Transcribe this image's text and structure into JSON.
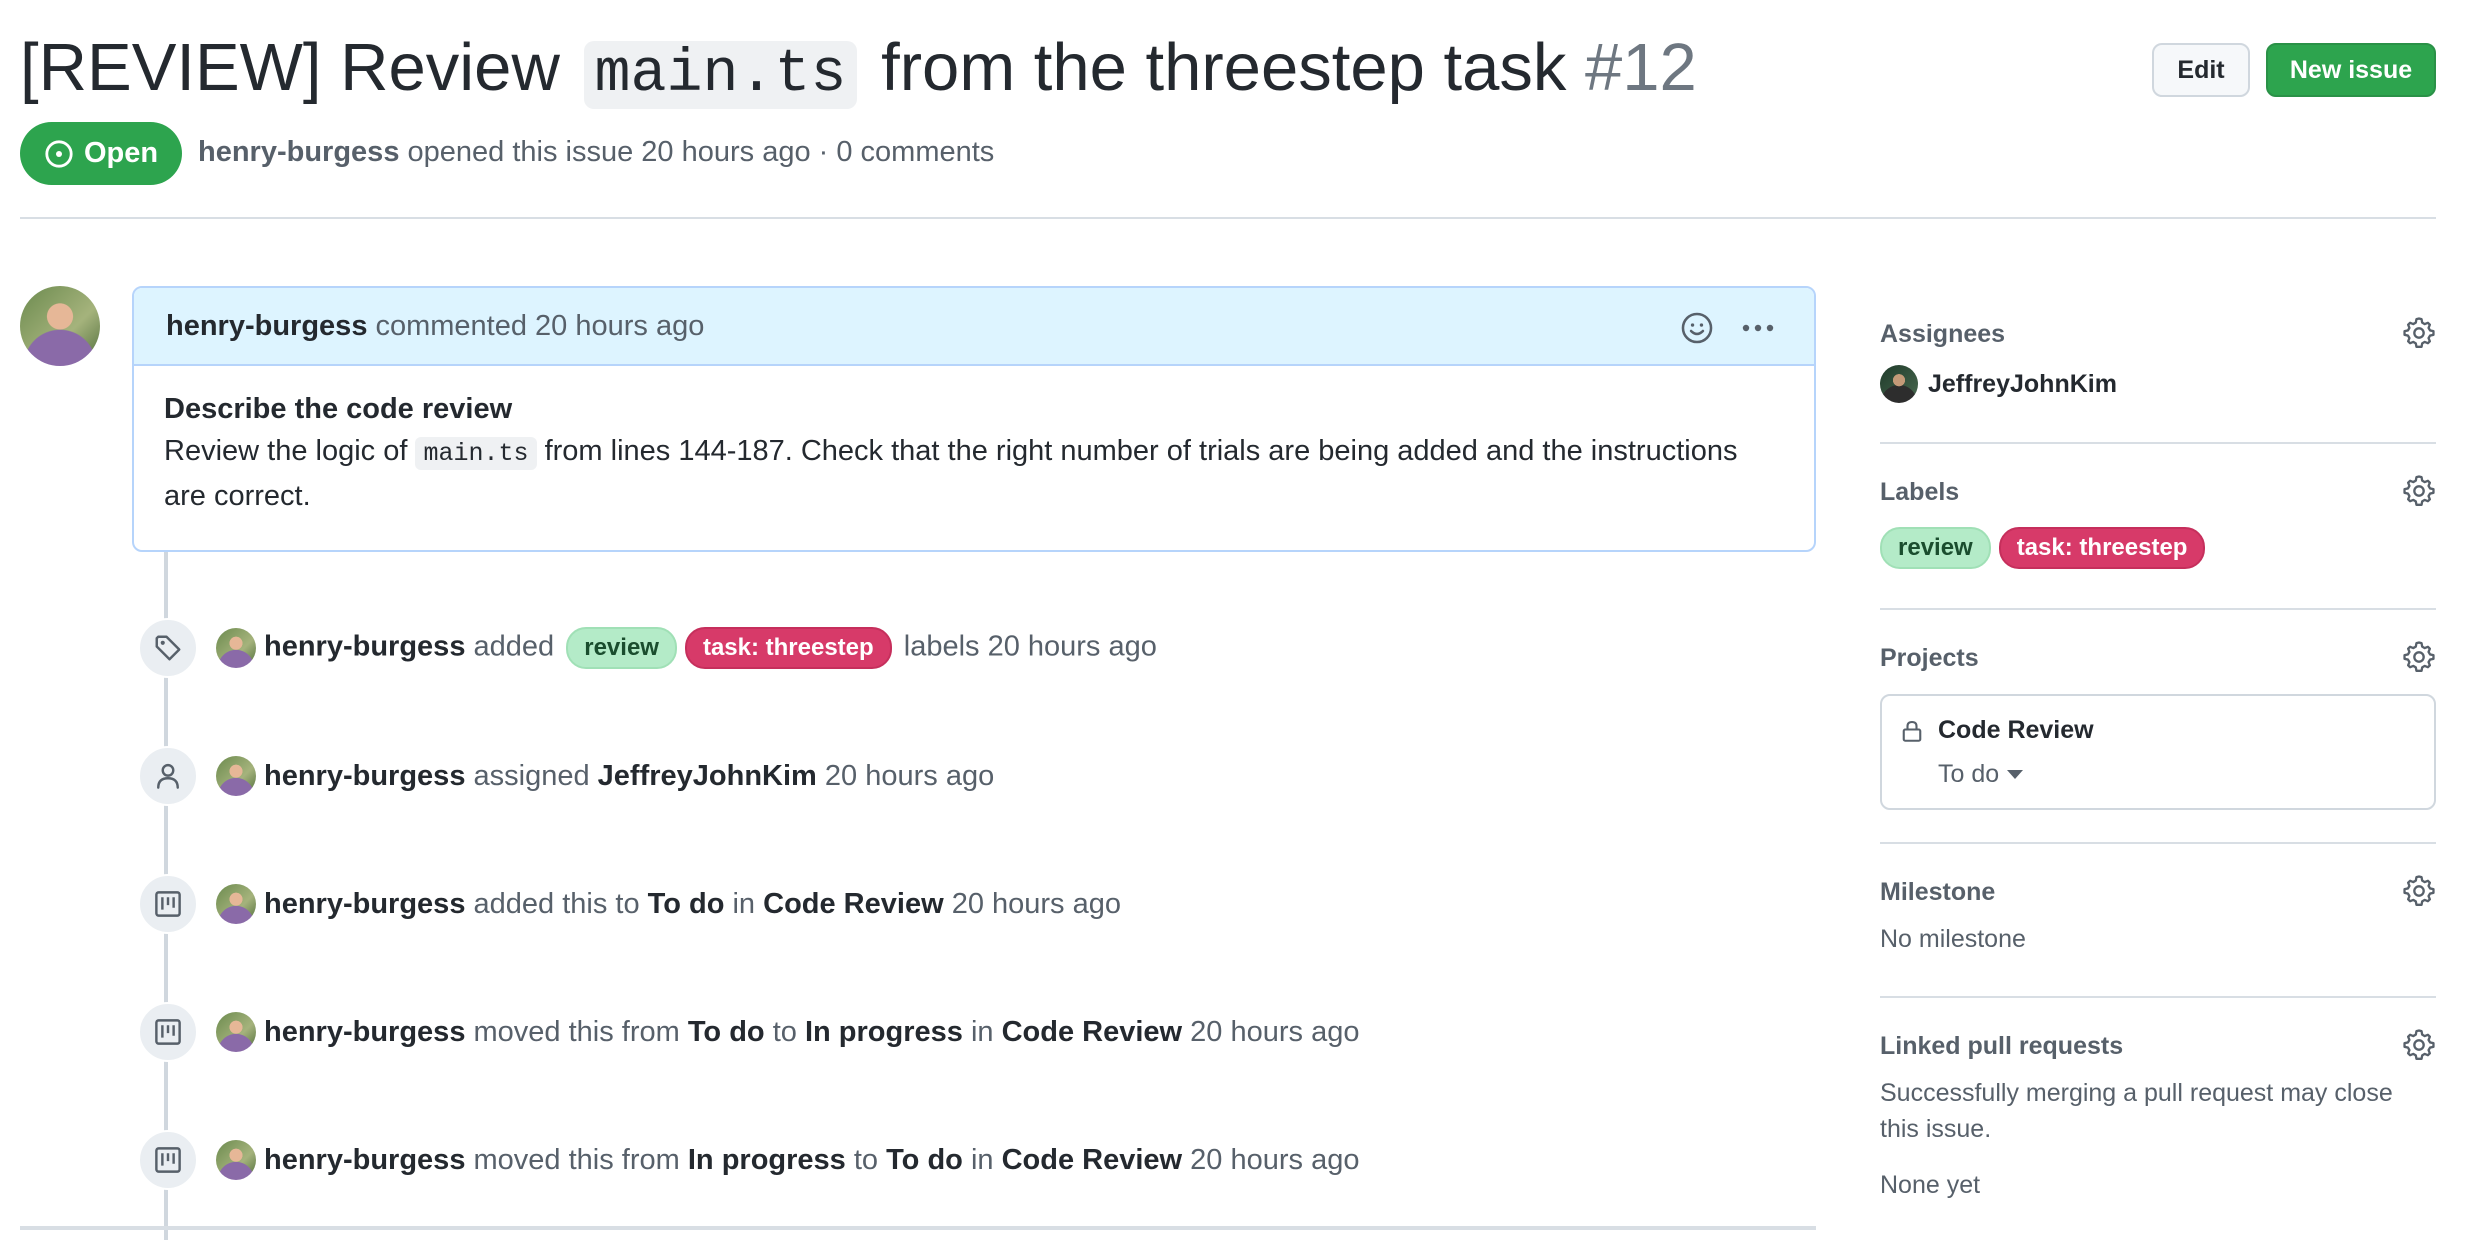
{
  "header": {
    "title_prefix": "[REVIEW] Review",
    "title_code": "main.ts",
    "title_suffix": "from the threestep task",
    "issue_number": "#12",
    "edit_label": "Edit",
    "new_issue_label": "New issue",
    "state": "Open",
    "author": "henry-burgess",
    "opened_text": "opened this issue 20 hours ago · 0 comments"
  },
  "comment": {
    "author": "henry-burgess",
    "meta": "commented 20 hours ago",
    "heading": "Describe the code review",
    "body_before": "Review the logic of",
    "body_code": "main.ts",
    "body_after": "from lines 144-187. Check that the right number of trials are being added and the instructions",
    "body_line2": "are correct."
  },
  "timeline": [
    {
      "icon": "tag-icon",
      "actor": "henry-burgess",
      "verb": "added",
      "labels": [
        "review",
        "task: threestep"
      ],
      "tail": "labels 20 hours ago"
    },
    {
      "icon": "person-icon",
      "actor": "henry-burgess",
      "verb": "assigned",
      "target": "JeffreyJohnKim",
      "tail": "20 hours ago"
    },
    {
      "icon": "project-icon",
      "actor": "henry-burgess",
      "verb": "added this to",
      "col": "To do",
      "in": "in",
      "project": "Code Review",
      "tail": "20 hours ago"
    },
    {
      "icon": "project-icon",
      "actor": "henry-burgess",
      "verb": "moved this from",
      "from": "To do",
      "to": "to",
      "col": "In progress",
      "in": "in",
      "project": "Code Review",
      "tail": "20 hours ago"
    },
    {
      "icon": "project-icon",
      "actor": "henry-burgess",
      "verb": "moved this from",
      "from": "In progress",
      "to": "to",
      "col": "To do",
      "in": "in",
      "project": "Code Review",
      "tail": "20 hours ago"
    }
  ],
  "sidebar": {
    "assignees": {
      "title": "Assignees",
      "user": "JeffreyJohnKim"
    },
    "labels": {
      "title": "Labels",
      "items": [
        "review",
        "task: threestep"
      ]
    },
    "projects": {
      "title": "Projects",
      "name": "Code Review",
      "column": "To do"
    },
    "milestone": {
      "title": "Milestone",
      "value": "No milestone"
    },
    "linked_prs": {
      "title": "Linked pull requests",
      "description": "Successfully merging a pull request may close this issue.",
      "value": "None yet"
    }
  },
  "colors": {
    "open_green": "#2da44e",
    "label_review": "#b4ebc8",
    "label_task": "#d73a69",
    "comment_header": "#ddf4ff"
  }
}
